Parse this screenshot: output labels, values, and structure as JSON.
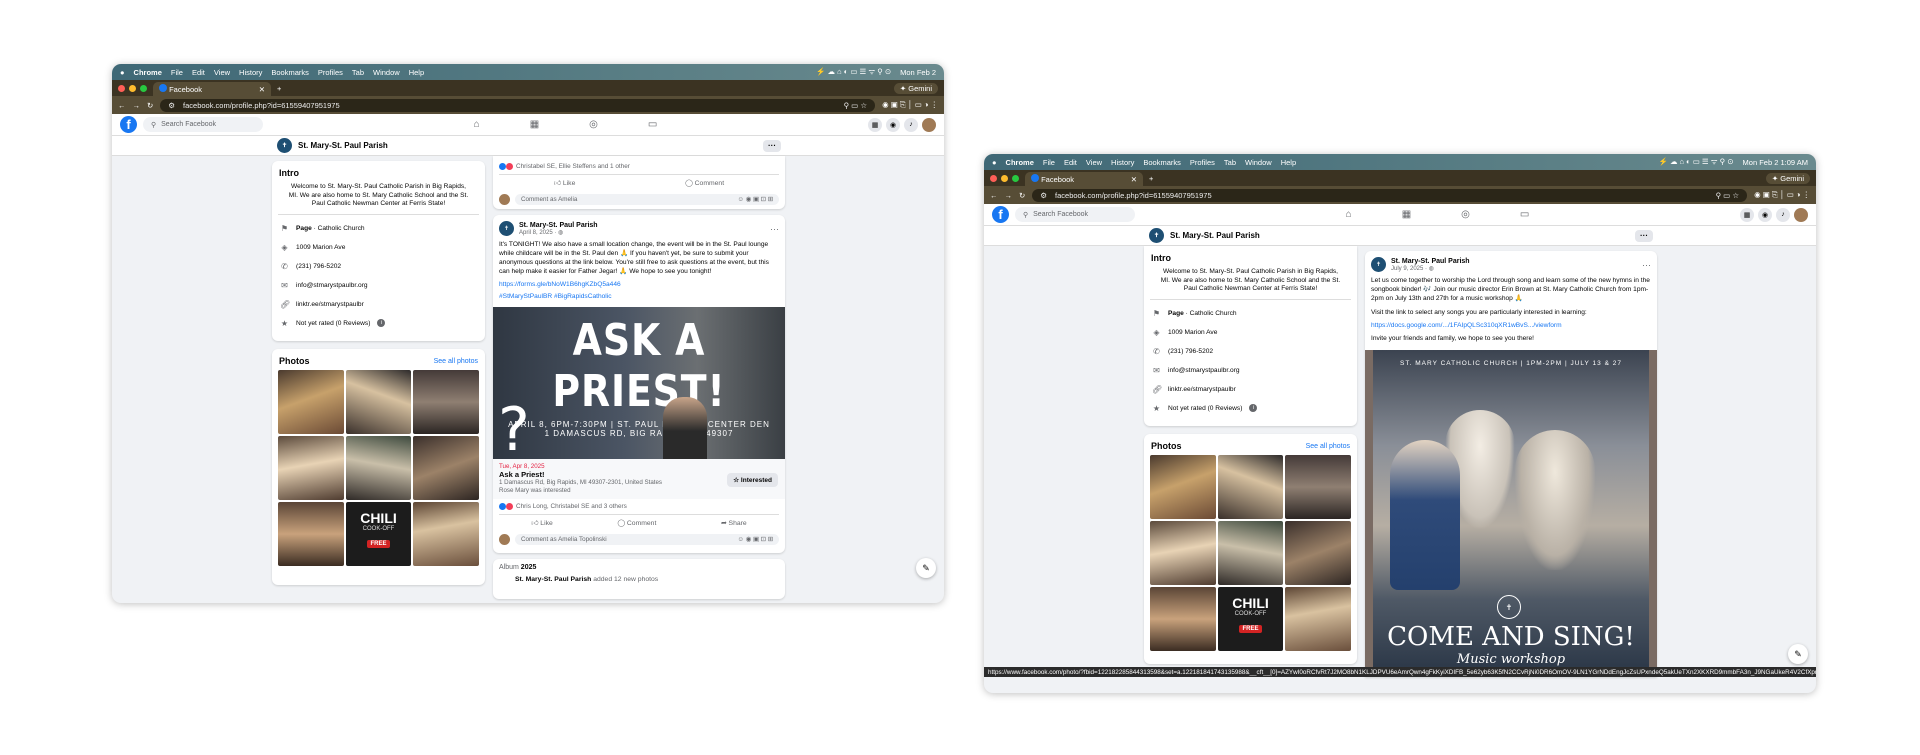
{
  "menubar": {
    "app": "Chrome",
    "items": [
      "File",
      "Edit",
      "View",
      "History",
      "Bookmarks",
      "Profiles",
      "Tab",
      "Window",
      "Help"
    ],
    "clock_left": "Mon Feb 2",
    "clock_right": "Mon Feb 2  1:09 AM"
  },
  "tab": {
    "title": "Facebook",
    "new_tab": "+",
    "gemini": "Gemini"
  },
  "address": {
    "url": "facebook.com/profile.php?id=61559407951975"
  },
  "fb": {
    "search_placeholder": "Search Facebook",
    "page_name": "St. Mary-St. Paul Parish",
    "more_label": "···"
  },
  "intro": {
    "heading": "Intro",
    "text": "Welcome to St. Mary-St. Paul Catholic Parish in Big Rapids, MI. We are also home to St. Mary Catholic School and the St. Paul Catholic Newman Center at Ferris State!",
    "page_label": "Page",
    "page_category": " · Catholic Church",
    "address": "1009 Marion Ave",
    "phone": "(231) 796-5202",
    "email": "info@stmarystpaulbr.org",
    "link": "linktr.ee/stmarystpaulbr",
    "rating": "Not yet rated (0 Reviews)",
    "info_glyph": "i"
  },
  "photos": {
    "heading": "Photos",
    "see_all": "See all photos",
    "chili": "CHILI",
    "cookoff": "COOK-OFF",
    "free": "FREE"
  },
  "post_top": {
    "reactions": "Christabel SE, Ellie Steffens and 1 other",
    "like": "Like",
    "comment": "Comment",
    "comment_placeholder": "Comment as Amelia"
  },
  "post1": {
    "author": "St. Mary-St. Paul Parish",
    "date": "April 8, 2025 · ",
    "text": "It's TONIGHT! We also have a small location change, the event will be in the St. Paul lounge while childcare will be in the St. Paul den 🙏 If you haven't yet, be sure to submit your anonymous questions at the link below. You're still free to ask questions at the event, but this can help make it easier for Father Jegar! 🙏 We hope to see you tonight!",
    "link": "https://forms.gle/bNoW1B6hgKZbQ5a446",
    "hashtags": "#StMaryStPaulBR #BigRapidsCatholic",
    "image_title": "ASK A PRIEST!",
    "image_line1": "APRIL 8, 6PM-7:30PM | ST. PAUL NEWMAN CENTER DEN",
    "image_line2": "1 DAMASCUS RD, BIG RAPIDS, MI 49307",
    "event_date": "Tue, Apr 8, 2025",
    "event_title": "Ask a Priest!",
    "event_location": "1 Damascus Rd, Big Rapids, MI 49307-2301, United States",
    "event_interested": "Rose Mary was interested",
    "interested_btn": "Interested",
    "reactions": "Chris Long, Christabel SE and 3 others",
    "like": "Like",
    "comment": "Comment",
    "share": "Share",
    "comment_placeholder": "Comment as Amelia Topolinski"
  },
  "album": {
    "label": "Album",
    "year": "2025",
    "author": "St. Mary-St. Paul Parish",
    "suffix": "added 12 new photos"
  },
  "post2": {
    "author": "St. Mary-St. Paul Parish",
    "date": "July 9, 2025 · ",
    "text1": "Let us come together to worship the Lord through song and learn some of the new hymns in the songbook binder! 🎶 Join our music director Erin Brown at St. Mary Catholic Church from 1pm-2pm on July 13th and 27th for a music workshop 🙏",
    "text2": "Visit the link to select any songs you are particularly interested in learning:",
    "link": "https://docs.google.com/.../1FAIpQLSc310qXR1wBvS.../viewform",
    "text3": "Invite your friends and family, we hope to see you there!",
    "image_header": "ST. MARY CATHOLIC CHURCH | 1PM-2PM | JULY 13 & 27",
    "image_title": "COME AND SING!",
    "image_sub": "Music workshop"
  },
  "statusbar": "https://www.facebook.com/photo/?fbid=122182285844313598&set=a.122181841743135988&__cft__[0]=AZYwI0oRCfvRt7J2MO8bN1KLJDPVU6eAmrQwn4gFkKyiXDIFB_5e62yb63K5fN2CCvRjNi0DR6OmOV-9LN1YGrNDdEngJcZsUPxndeQ5akUeTXn2XKXRD9mmbFA3n_J9NGaUkeR4V2CfXpr8XUTT5qN"
}
